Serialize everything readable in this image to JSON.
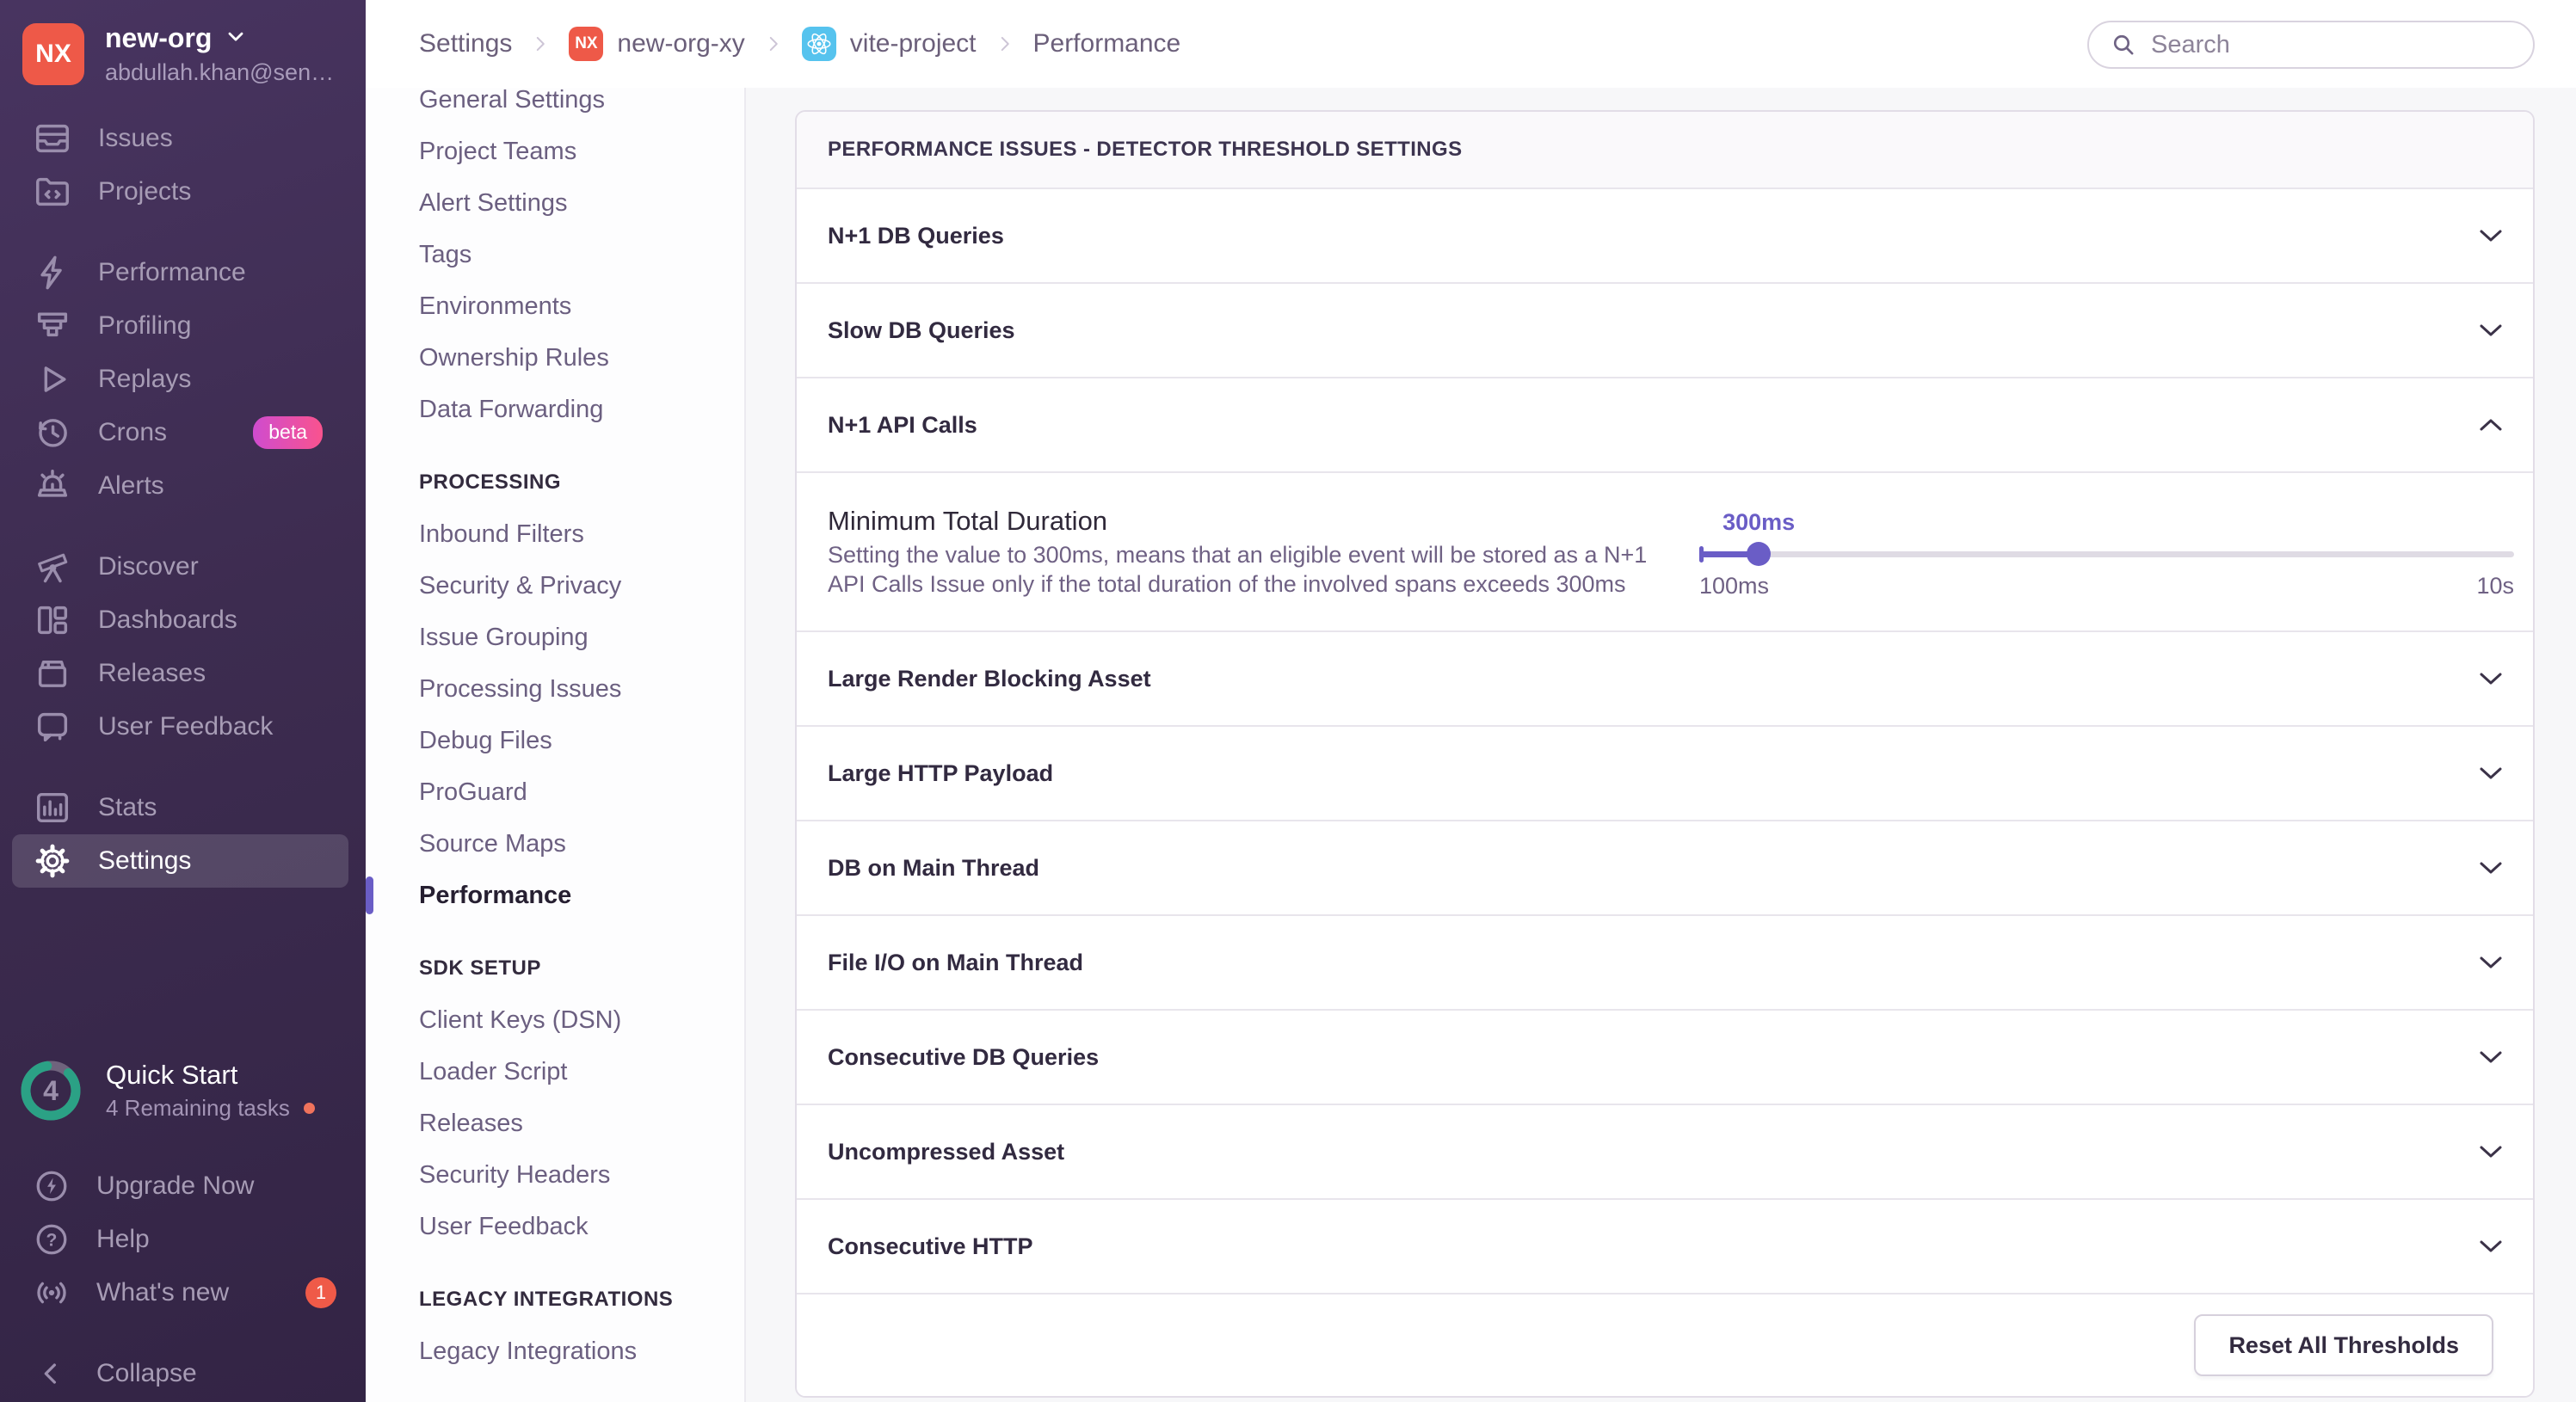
{
  "sidebar": {
    "org": {
      "initials": "NX",
      "name": "new-org",
      "email": "abdullah.khan@sen…"
    },
    "nav": [
      {
        "label": "Issues",
        "icon": "issues-icon"
      },
      {
        "label": "Projects",
        "icon": "projects-icon"
      },
      {
        "label": "Performance",
        "icon": "performance-icon",
        "group_break": true
      },
      {
        "label": "Profiling",
        "icon": "profiling-icon"
      },
      {
        "label": "Replays",
        "icon": "replays-icon"
      },
      {
        "label": "Crons",
        "icon": "crons-icon",
        "badge": "beta"
      },
      {
        "label": "Alerts",
        "icon": "alerts-icon"
      },
      {
        "label": "Discover",
        "icon": "discover-icon",
        "group_break": true
      },
      {
        "label": "Dashboards",
        "icon": "dashboards-icon"
      },
      {
        "label": "Releases",
        "icon": "releases-icon"
      },
      {
        "label": "User Feedback",
        "icon": "user-feedback-icon"
      },
      {
        "label": "Stats",
        "icon": "stats-icon",
        "group_break": true
      },
      {
        "label": "Settings",
        "icon": "settings-icon",
        "active": true
      }
    ],
    "quick_start": {
      "title": "Quick Start",
      "subtitle": "4 Remaining tasks",
      "count": "4"
    },
    "utilities": [
      {
        "label": "Upgrade Now",
        "icon": "upgrade-icon"
      },
      {
        "label": "Help",
        "icon": "help-icon"
      },
      {
        "label": "What's new",
        "icon": "whats-new-icon",
        "badge": "1"
      }
    ],
    "collapse_label": "Collapse"
  },
  "secondary_nav": {
    "active": "Performance",
    "sections": [
      {
        "header": "",
        "items": [
          "General Settings",
          "Project Teams",
          "Alert Settings",
          "Tags",
          "Environments",
          "Ownership Rules",
          "Data Forwarding"
        ]
      },
      {
        "header": "PROCESSING",
        "items": [
          "Inbound Filters",
          "Security & Privacy",
          "Issue Grouping",
          "Processing Issues",
          "Debug Files",
          "ProGuard",
          "Source Maps",
          "Performance"
        ]
      },
      {
        "header": "SDK SETUP",
        "items": [
          "Client Keys (DSN)",
          "Loader Script",
          "Releases",
          "Security Headers",
          "User Feedback"
        ]
      },
      {
        "header": "LEGACY INTEGRATIONS",
        "items": [
          "Legacy Integrations"
        ]
      }
    ]
  },
  "topbar": {
    "breadcrumb": [
      {
        "label": "Settings"
      },
      {
        "label": "new-org-xy",
        "badge_text": "NX"
      },
      {
        "label": "vite-project",
        "badge_icon": "react-icon"
      },
      {
        "label": "Performance"
      }
    ],
    "search": {
      "placeholder": "Search"
    }
  },
  "panel": {
    "header": "PERFORMANCE ISSUES - DETECTOR THRESHOLD SETTINGS",
    "detectors": [
      {
        "label": "N+1 DB Queries"
      },
      {
        "label": "Slow DB Queries"
      },
      {
        "label": "N+1 API Calls",
        "expanded": true
      },
      {
        "label": "Large Render Blocking Asset"
      },
      {
        "label": "Large HTTP Payload"
      },
      {
        "label": "DB on Main Thread"
      },
      {
        "label": "File I/O on Main Thread"
      },
      {
        "label": "Consecutive DB Queries"
      },
      {
        "label": "Uncompressed Asset"
      },
      {
        "label": "Consecutive HTTP"
      }
    ],
    "footer_button": "Reset All Thresholds"
  },
  "detail": {
    "title": "Minimum Total Duration",
    "description": "Setting the value to 300ms, means that an eligible event will be stored as a N+1 API Calls Issue only if the total duration of the involved spans exceeds 300ms",
    "slider": {
      "value": "300ms",
      "min": "100ms",
      "max": "10s",
      "percent": 7.3
    }
  },
  "colors": {
    "accent_purple": "#6A5DC6",
    "avatar_red": "#EE5948",
    "quickstart_teal": "#2BA185",
    "badge_red": "#EF5A48",
    "beta_gradient_start": "#CF4CCF",
    "beta_gradient_end": "#F9538E",
    "sidebar_top": "#483460",
    "sidebar_bottom": "#332445"
  }
}
